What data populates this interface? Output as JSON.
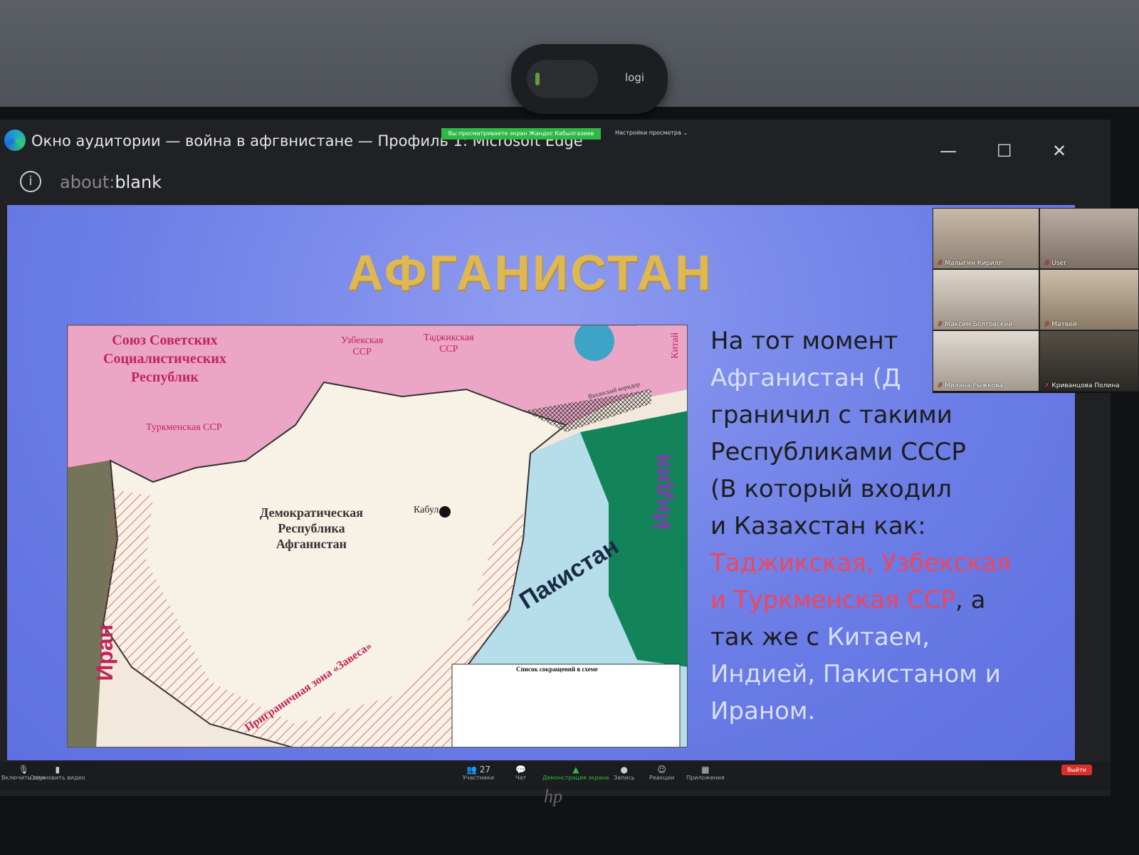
{
  "webcam": {
    "brand": "logi"
  },
  "window": {
    "title": "Окно аудитории — война в афгвнистане — Профиль 1: Microsoft Edge",
    "share_notice": "Вы просматриваете экран Жандос Кабылгазиев",
    "view_options": "Настройки просмотра ⌄",
    "minimize": "—",
    "maximize": "☐",
    "close": "✕"
  },
  "address": {
    "prefix": "about:",
    "host": "blank"
  },
  "slide": {
    "title": "АФГАНИСТАН",
    "map": {
      "ussr": "Союз Советских\nСоциалистических\nРеспублик",
      "uzbek": "Узбекская\nССР",
      "tajik": "Таджикская\nССР",
      "china": "Китай",
      "turkmen": "Туркменская ССР",
      "dra": "Демократическая\nРеспублика\nАфганистан",
      "kabul": "Кабул",
      "india": "Индия",
      "pakistan": "Пакистан",
      "iran": "Иран",
      "border_zone": "Приграничная зона «Завеса»",
      "wakhan": "Ваханский коридор",
      "legend_title": "Список сокращений в схеме"
    },
    "text": {
      "line1": "На тот момент",
      "line2": "Афганистан (Д",
      "line3": "граничил с такими",
      "line4": "Республиками СССР",
      "line5": "(В который входил",
      "line6": "и Казахстан как:",
      "red1": "Таджикская,  Узбекская",
      "red2": "и Туркменская ССР",
      "after_red": ", а",
      "line9a": "так же с ",
      "line9b": "Китаем,",
      "line10": "Индией, Пакистаном и",
      "line11": "Ираном."
    }
  },
  "participants": [
    {
      "name": "Малыгин Кирилл"
    },
    {
      "name": "User"
    },
    {
      "name": "Максим Болтовский"
    },
    {
      "name": "Матвей"
    },
    {
      "name": "Милана Рыжкова"
    },
    {
      "name": "Криванцова Полина"
    }
  ],
  "toolbar": {
    "mute": "Включить звук",
    "video": "Остановить видео",
    "participants": "Участники",
    "participants_count": "27",
    "chat": "Чат",
    "share": "Демонстрация экрана",
    "record": "Запись",
    "reactions": "Реакции",
    "apps": "Приложения",
    "leave": "Выйти"
  },
  "monitor": {
    "brand": "hp"
  }
}
